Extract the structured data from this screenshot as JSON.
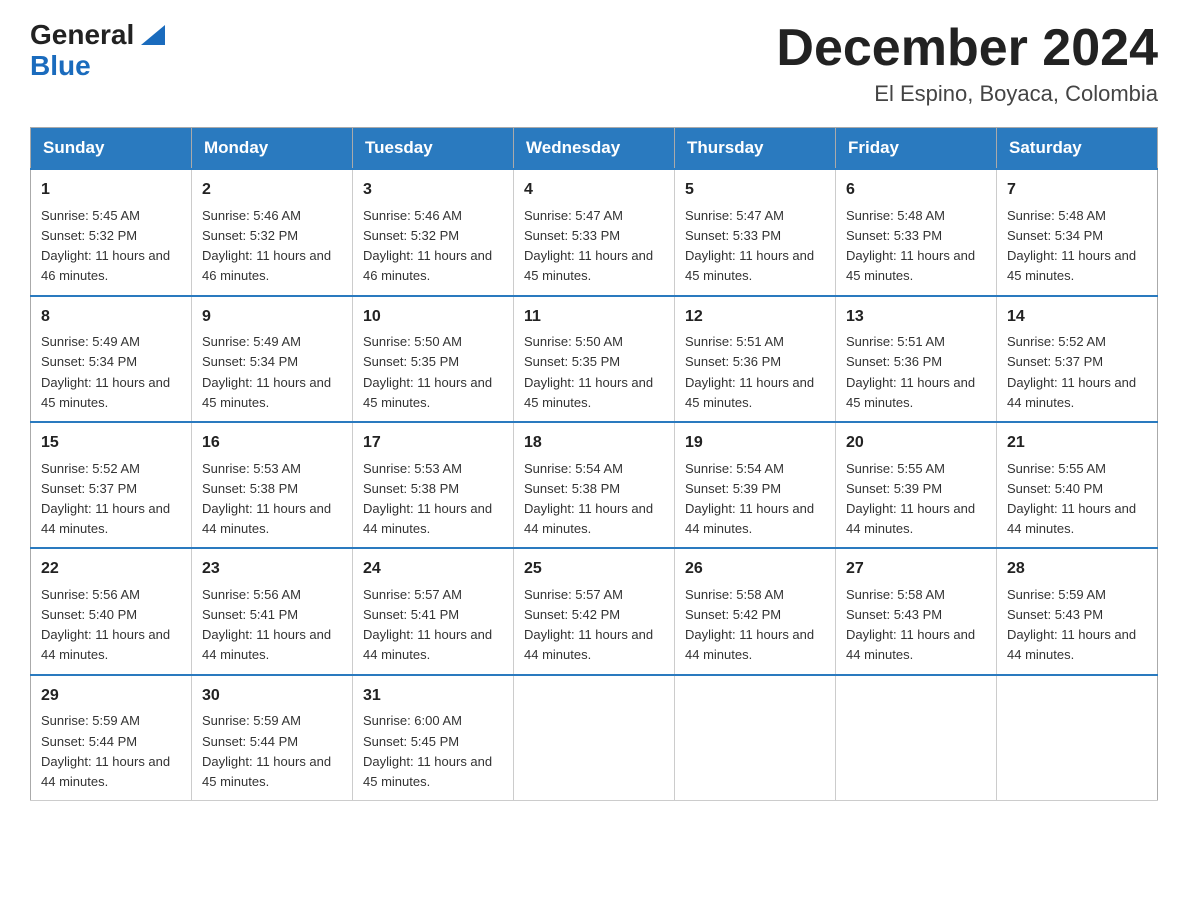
{
  "logo": {
    "text_general": "General",
    "text_blue": "Blue",
    "icon_color": "#1a6bbd"
  },
  "title": {
    "month_year": "December 2024",
    "location": "El Espino, Boyaca, Colombia"
  },
  "headers": [
    "Sunday",
    "Monday",
    "Tuesday",
    "Wednesday",
    "Thursday",
    "Friday",
    "Saturday"
  ],
  "weeks": [
    [
      {
        "day": "1",
        "sunrise": "5:45 AM",
        "sunset": "5:32 PM",
        "daylight": "11 hours and 46 minutes."
      },
      {
        "day": "2",
        "sunrise": "5:46 AM",
        "sunset": "5:32 PM",
        "daylight": "11 hours and 46 minutes."
      },
      {
        "day": "3",
        "sunrise": "5:46 AM",
        "sunset": "5:32 PM",
        "daylight": "11 hours and 46 minutes."
      },
      {
        "day": "4",
        "sunrise": "5:47 AM",
        "sunset": "5:33 PM",
        "daylight": "11 hours and 45 minutes."
      },
      {
        "day": "5",
        "sunrise": "5:47 AM",
        "sunset": "5:33 PM",
        "daylight": "11 hours and 45 minutes."
      },
      {
        "day": "6",
        "sunrise": "5:48 AM",
        "sunset": "5:33 PM",
        "daylight": "11 hours and 45 minutes."
      },
      {
        "day": "7",
        "sunrise": "5:48 AM",
        "sunset": "5:34 PM",
        "daylight": "11 hours and 45 minutes."
      }
    ],
    [
      {
        "day": "8",
        "sunrise": "5:49 AM",
        "sunset": "5:34 PM",
        "daylight": "11 hours and 45 minutes."
      },
      {
        "day": "9",
        "sunrise": "5:49 AM",
        "sunset": "5:34 PM",
        "daylight": "11 hours and 45 minutes."
      },
      {
        "day": "10",
        "sunrise": "5:50 AM",
        "sunset": "5:35 PM",
        "daylight": "11 hours and 45 minutes."
      },
      {
        "day": "11",
        "sunrise": "5:50 AM",
        "sunset": "5:35 PM",
        "daylight": "11 hours and 45 minutes."
      },
      {
        "day": "12",
        "sunrise": "5:51 AM",
        "sunset": "5:36 PM",
        "daylight": "11 hours and 45 minutes."
      },
      {
        "day": "13",
        "sunrise": "5:51 AM",
        "sunset": "5:36 PM",
        "daylight": "11 hours and 45 minutes."
      },
      {
        "day": "14",
        "sunrise": "5:52 AM",
        "sunset": "5:37 PM",
        "daylight": "11 hours and 44 minutes."
      }
    ],
    [
      {
        "day": "15",
        "sunrise": "5:52 AM",
        "sunset": "5:37 PM",
        "daylight": "11 hours and 44 minutes."
      },
      {
        "day": "16",
        "sunrise": "5:53 AM",
        "sunset": "5:38 PM",
        "daylight": "11 hours and 44 minutes."
      },
      {
        "day": "17",
        "sunrise": "5:53 AM",
        "sunset": "5:38 PM",
        "daylight": "11 hours and 44 minutes."
      },
      {
        "day": "18",
        "sunrise": "5:54 AM",
        "sunset": "5:38 PM",
        "daylight": "11 hours and 44 minutes."
      },
      {
        "day": "19",
        "sunrise": "5:54 AM",
        "sunset": "5:39 PM",
        "daylight": "11 hours and 44 minutes."
      },
      {
        "day": "20",
        "sunrise": "5:55 AM",
        "sunset": "5:39 PM",
        "daylight": "11 hours and 44 minutes."
      },
      {
        "day": "21",
        "sunrise": "5:55 AM",
        "sunset": "5:40 PM",
        "daylight": "11 hours and 44 minutes."
      }
    ],
    [
      {
        "day": "22",
        "sunrise": "5:56 AM",
        "sunset": "5:40 PM",
        "daylight": "11 hours and 44 minutes."
      },
      {
        "day": "23",
        "sunrise": "5:56 AM",
        "sunset": "5:41 PM",
        "daylight": "11 hours and 44 minutes."
      },
      {
        "day": "24",
        "sunrise": "5:57 AM",
        "sunset": "5:41 PM",
        "daylight": "11 hours and 44 minutes."
      },
      {
        "day": "25",
        "sunrise": "5:57 AM",
        "sunset": "5:42 PM",
        "daylight": "11 hours and 44 minutes."
      },
      {
        "day": "26",
        "sunrise": "5:58 AM",
        "sunset": "5:42 PM",
        "daylight": "11 hours and 44 minutes."
      },
      {
        "day": "27",
        "sunrise": "5:58 AM",
        "sunset": "5:43 PM",
        "daylight": "11 hours and 44 minutes."
      },
      {
        "day": "28",
        "sunrise": "5:59 AM",
        "sunset": "5:43 PM",
        "daylight": "11 hours and 44 minutes."
      }
    ],
    [
      {
        "day": "29",
        "sunrise": "5:59 AM",
        "sunset": "5:44 PM",
        "daylight": "11 hours and 44 minutes."
      },
      {
        "day": "30",
        "sunrise": "5:59 AM",
        "sunset": "5:44 PM",
        "daylight": "11 hours and 45 minutes."
      },
      {
        "day": "31",
        "sunrise": "6:00 AM",
        "sunset": "5:45 PM",
        "daylight": "11 hours and 45 minutes."
      },
      null,
      null,
      null,
      null
    ]
  ]
}
